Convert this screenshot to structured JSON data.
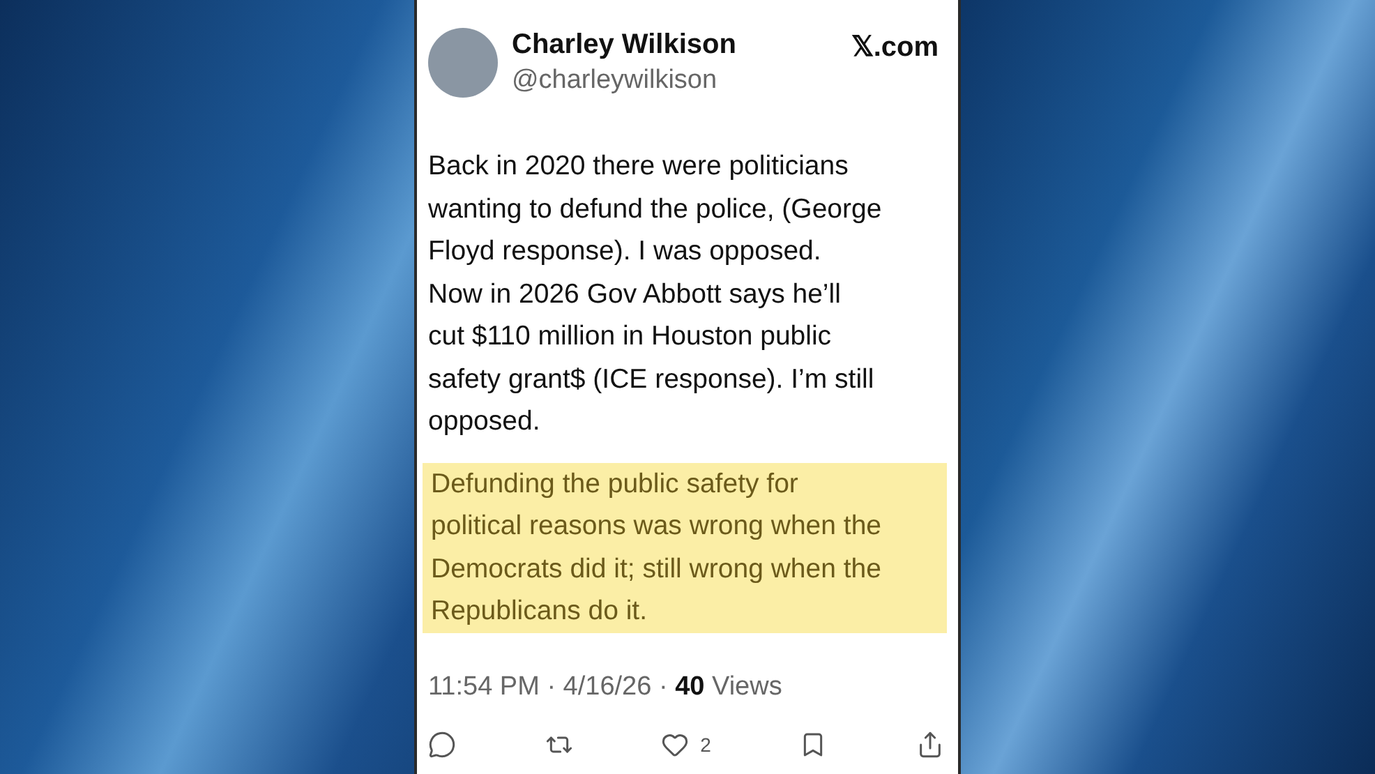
{
  "post": {
    "author": {
      "name": "Charley Wilkison",
      "handle": "@charleywilkison"
    },
    "source": "𝕏.com",
    "paragraphs": [
      {
        "highlighted": false,
        "lines": [
          "Back in 2020 there were politicians",
          "wanting to defund the police, (George",
          "Floyd response). I was opposed.",
          "Now in 2026 Gov Abbott  says he’ll",
          "cut $110 million in Houston public",
          "safety grant$ (ICE response). I’m still",
          "opposed."
        ]
      },
      {
        "highlighted": true,
        "lines": [
          "Defunding the public safety for",
          "political reasons was wrong when the",
          "Democrats did it; still wrong when the",
          "Republicans do it."
        ]
      }
    ],
    "meta": "11:54 PM · 4/16/26 · **40** Views",
    "actions": [
      {
        "kind": "reply"
      },
      {
        "kind": "repost"
      },
      {
        "kind": "like",
        "count": "2"
      },
      {
        "kind": "bookmark"
      },
      {
        "kind": "share"
      }
    ]
  }
}
